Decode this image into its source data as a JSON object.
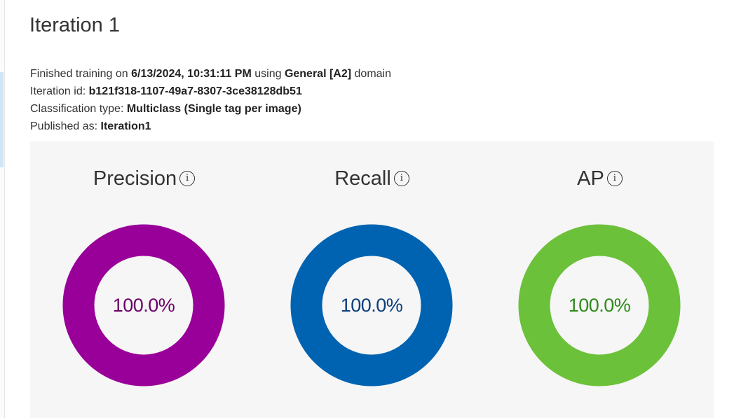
{
  "page": {
    "title": "Iteration 1"
  },
  "details": {
    "finished_prefix": "Finished training on",
    "finished_date": "6/13/2024, 10:31:11 PM",
    "using_text": "using",
    "domain_name": "General [A2]",
    "domain_suffix": "domain",
    "iteration_id_label": "Iteration id:",
    "iteration_id": "b121f318-1107-49a7-8307-3ce38128db51",
    "classification_label": "Classification type:",
    "classification_type": "Multiclass (Single tag per image)",
    "published_label": "Published as:",
    "published_name": "Iteration1"
  },
  "metrics": [
    {
      "label": "Precision",
      "value_text": "100.0%",
      "value": 1.0,
      "ring_color": "#990099",
      "text_color": "#6a0068",
      "icon": "info-icon"
    },
    {
      "label": "Recall",
      "value_text": "100.0%",
      "value": 1.0,
      "ring_color": "#0063b1",
      "text_color": "#0b3e7a",
      "icon": "info-icon"
    },
    {
      "label": "AP",
      "value_text": "100.0%",
      "value": 1.0,
      "ring_color": "#6cc13a",
      "text_color": "#2f8a1a",
      "icon": "info-icon"
    }
  ]
}
